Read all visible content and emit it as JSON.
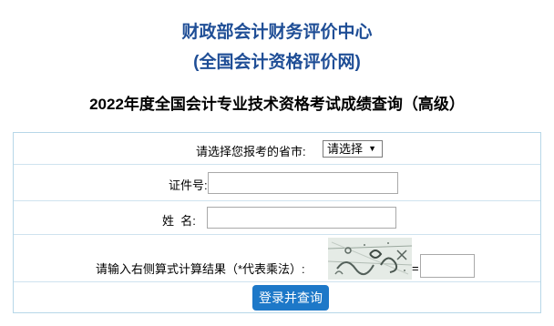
{
  "header": {
    "org_line1": "财政部会计财务评价中心",
    "org_line2": "(全国会计资格评价网)",
    "title": "2022年度全国会计专业技术资格考试成绩查询（高级）"
  },
  "form": {
    "province_label": "请选择您报考的省市:",
    "province_selected": "请选择",
    "id_label": "证件号:",
    "id_value": "",
    "name_label": "姓  名:",
    "name_value": "",
    "captcha_label": "请输入右侧算式计算结果（*代表乘法）:",
    "equals": "=",
    "captcha_answer": "",
    "submit_label": "登录并查询"
  }
}
